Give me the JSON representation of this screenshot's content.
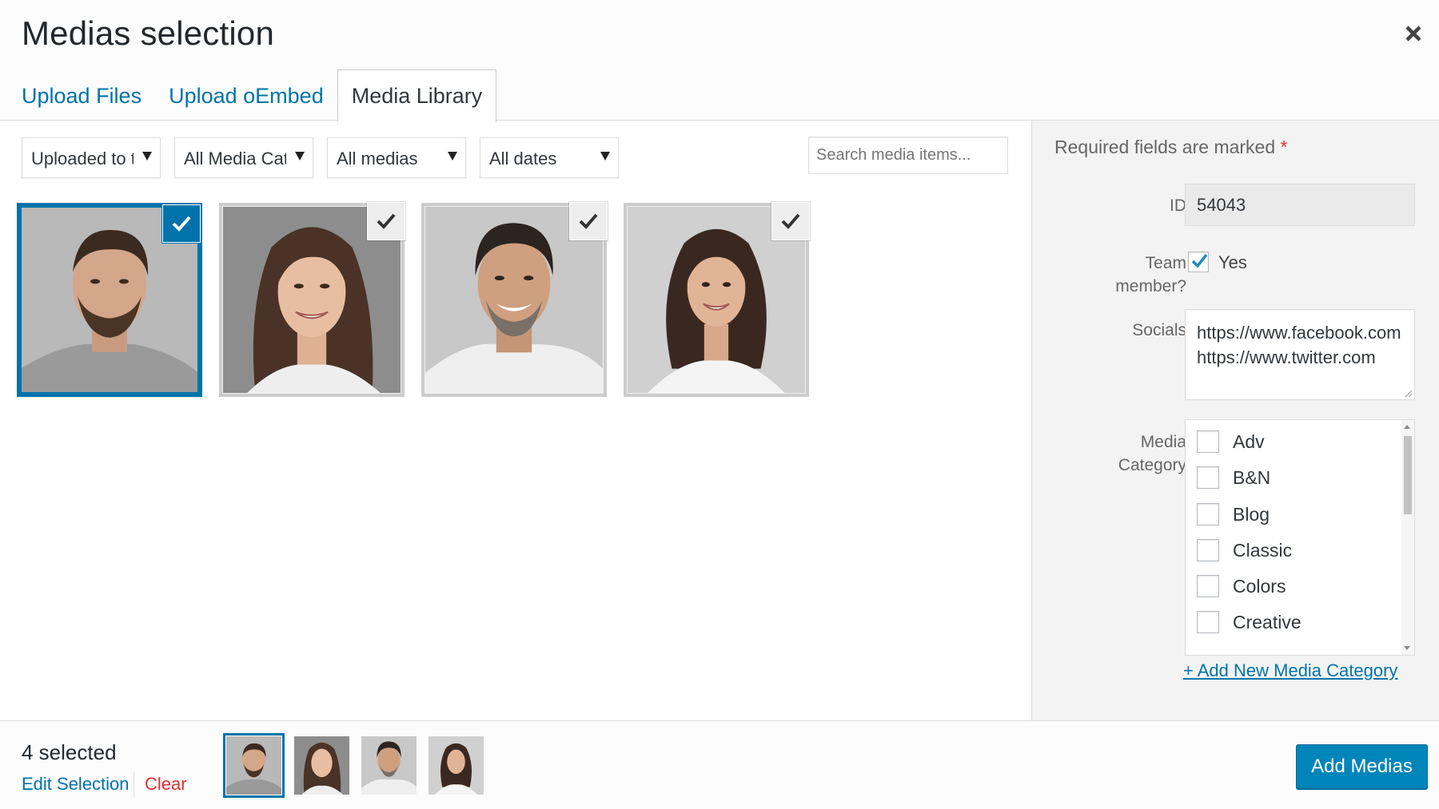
{
  "modal": {
    "title": "Medias selection",
    "tabs": [
      {
        "label": "Upload Files"
      },
      {
        "label": "Upload oEmbed"
      },
      {
        "label": "Media Library"
      }
    ]
  },
  "toolbar": {
    "filters": [
      {
        "value": "Uploaded to t"
      },
      {
        "value": "All Media Cat"
      },
      {
        "value": "All medias"
      },
      {
        "value": "All dates"
      }
    ],
    "search_placeholder": "Search media items..."
  },
  "grid": {
    "items": [
      {
        "name": "portrait-man-beard",
        "selected": true,
        "active": true
      },
      {
        "name": "portrait-woman-smiling",
        "selected": true,
        "active": false
      },
      {
        "name": "portrait-man-grey-beard",
        "selected": true,
        "active": false
      },
      {
        "name": "portrait-woman-curly-hair",
        "selected": true,
        "active": false
      }
    ]
  },
  "sidebar": {
    "required_note": "Required fields are marked",
    "required_star": "*",
    "id_label": "ID",
    "id_value": "54043",
    "team_label_1": "Team",
    "team_label_2": "member?",
    "team_checked": true,
    "team_value": "Yes",
    "socials_label": "Socials",
    "socials": [
      "https://www.facebook.com",
      "https://www.twitter.com"
    ],
    "category_label_1": "Media",
    "category_label_2": "Category",
    "categories": [
      {
        "label": "Adv",
        "checked": false
      },
      {
        "label": "B&N",
        "checked": false
      },
      {
        "label": "Blog",
        "checked": false
      },
      {
        "label": "Classic",
        "checked": false
      },
      {
        "label": "Colors",
        "checked": false
      },
      {
        "label": "Creative",
        "checked": false
      }
    ],
    "add_category": "+ Add New Media Category"
  },
  "footer": {
    "count": "4 selected",
    "edit_selection": "Edit Selection",
    "clear": "Clear",
    "add_button": "Add Medias"
  },
  "colors": {
    "accent": "#0073aa",
    "button": "#0085ba",
    "danger": "#dc3232"
  }
}
